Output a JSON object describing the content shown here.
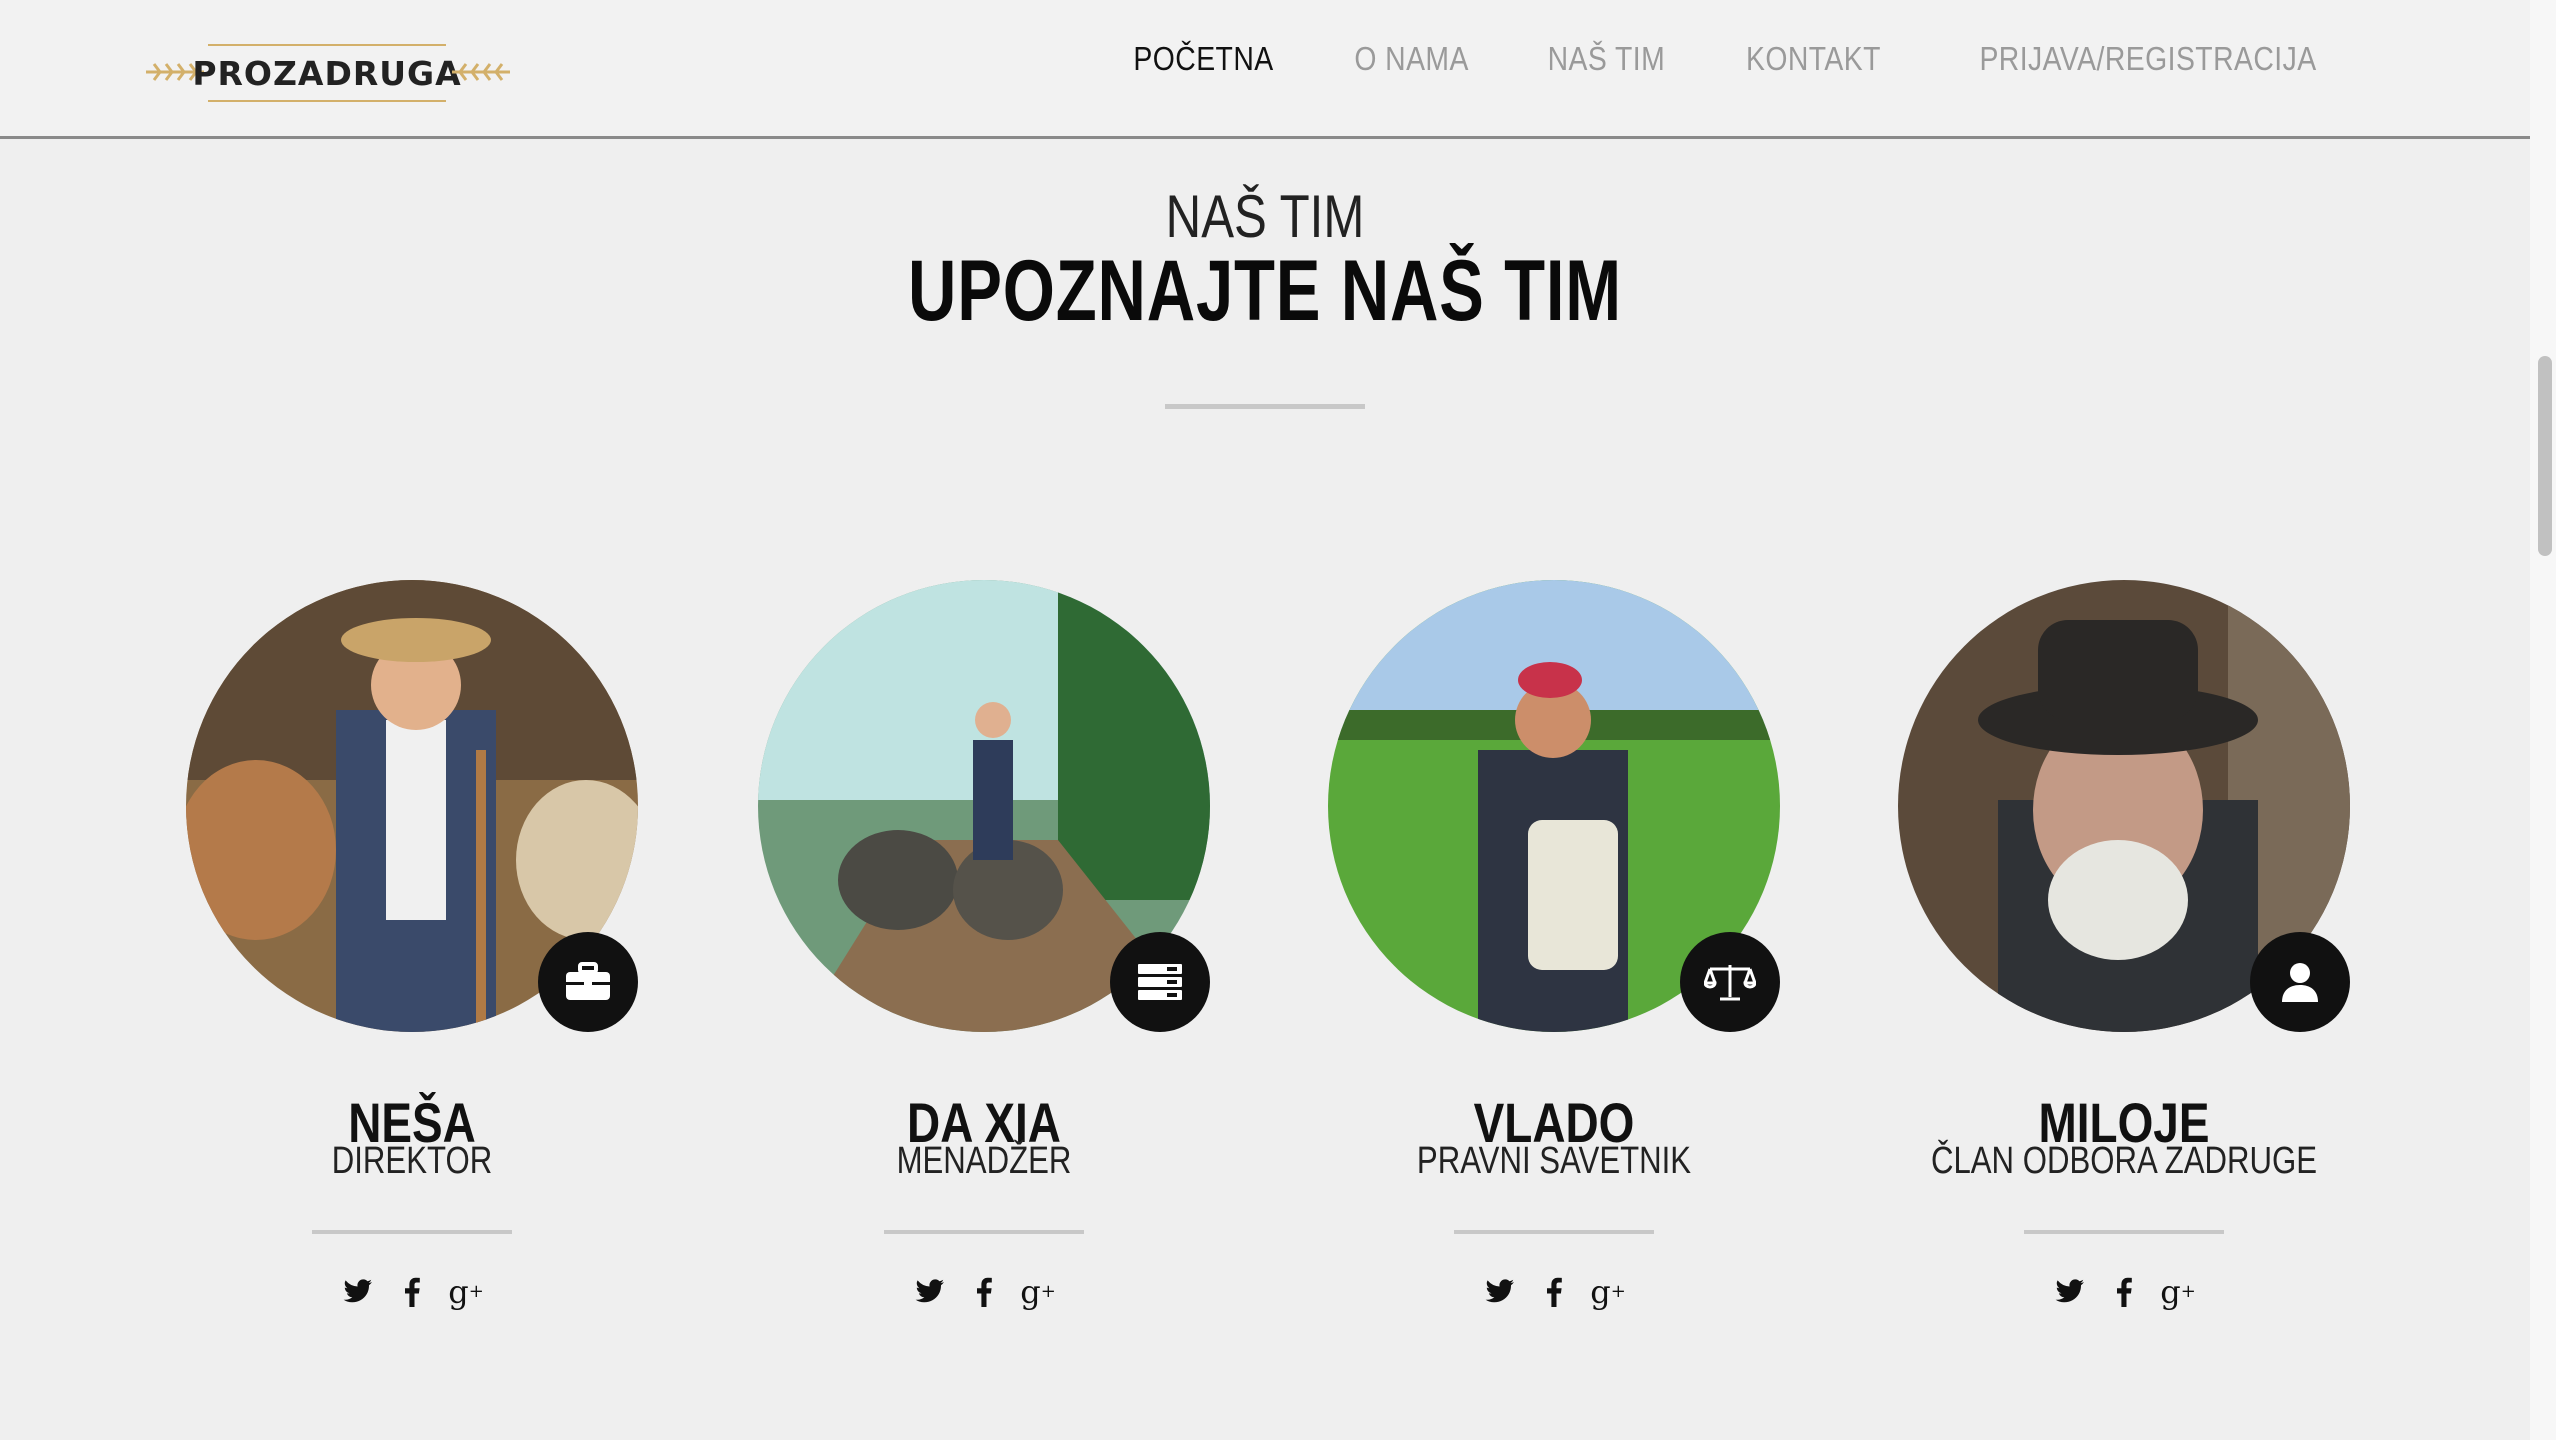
{
  "brand": {
    "name": "PROZADRUGA",
    "accent": "#d3b06a"
  },
  "nav": {
    "items": [
      {
        "label": "POČETNA",
        "active": true
      },
      {
        "label": "O NAMA",
        "active": false
      },
      {
        "label": "NAŠ TIM",
        "active": false
      },
      {
        "label": "KONTAKT",
        "active": false
      },
      {
        "label": "PRIJAVA/REGISTRACIJA",
        "active": false
      }
    ]
  },
  "section": {
    "subtitle": "NAŠ TIM",
    "title": "UPOZNAJTE NAŠ TIM"
  },
  "team": [
    {
      "name": "NEŠA",
      "role": "DIREKTOR",
      "icon": "briefcase-icon"
    },
    {
      "name": "DA XIA",
      "role": "MENADŽER",
      "icon": "server-icon"
    },
    {
      "name": "VLADO",
      "role": "PRAVNI SAVETNIK",
      "icon": "scale-icon"
    },
    {
      "name": "MILOJE",
      "role": "ČLAN ODBORA ZADRUGE",
      "icon": "user-icon"
    }
  ],
  "social": {
    "twitter": "twitter-icon",
    "facebook": "facebook-icon",
    "googleplus": "google-plus-icon"
  }
}
